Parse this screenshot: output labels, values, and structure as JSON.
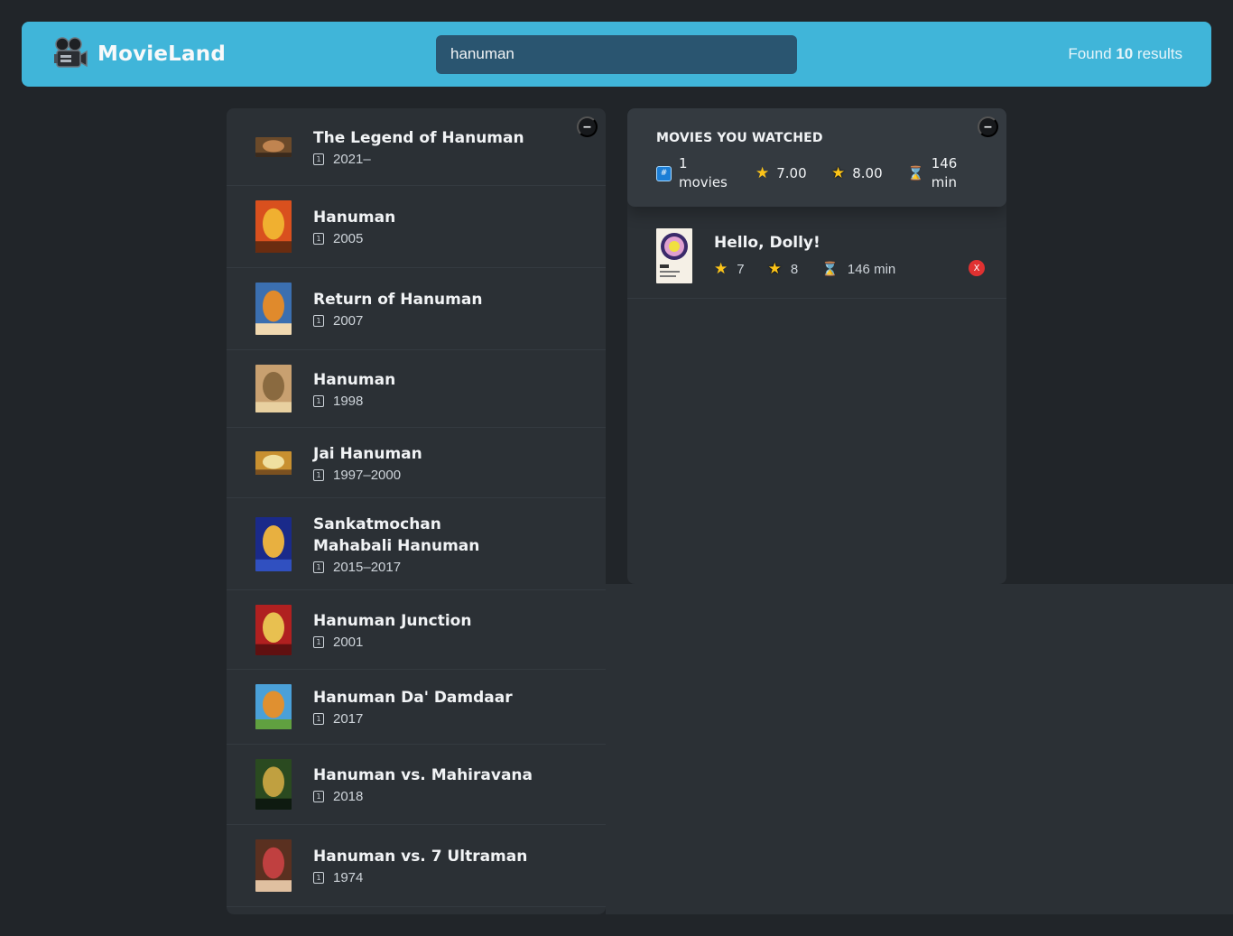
{
  "nav": {
    "logo_text": "MovieLand",
    "search_value": "hanuman",
    "results_prefix": "Found ",
    "results_count": "10",
    "results_suffix": " results"
  },
  "list_toggle": "–",
  "movies": [
    {
      "title": "The Legend of Hanuman",
      "year": "2021–",
      "poster_colors": [
        "#6b4a2a",
        "#c08450",
        "#3a2a1d"
      ]
    },
    {
      "title": "Hanuman",
      "year": "2005",
      "poster_colors": [
        "#d9501e",
        "#f0b030",
        "#6a2c10"
      ]
    },
    {
      "title": "Return of Hanuman",
      "year": "2007",
      "poster_colors": [
        "#3b6fb0",
        "#e08a2c",
        "#f0d8b0"
      ]
    },
    {
      "title": "Hanuman",
      "year": "1998",
      "poster_colors": [
        "#c8a070",
        "#8a6a40",
        "#e8d0a0"
      ]
    },
    {
      "title": "Jai Hanuman",
      "year": "1997–2000",
      "poster_colors": [
        "#c89030",
        "#f0e0a0",
        "#7a5020"
      ]
    },
    {
      "title": "Sankatmochan Mahabali Hanuman",
      "year": "2015–2017",
      "poster_colors": [
        "#1a2a8a",
        "#e8b040",
        "#3050c0"
      ]
    },
    {
      "title": "Hanuman Junction",
      "year": "2001",
      "poster_colors": [
        "#b02020",
        "#e8c050",
        "#601010"
      ]
    },
    {
      "title": "Hanuman Da' Damdaar",
      "year": "2017",
      "poster_colors": [
        "#4aa0d8",
        "#e09030",
        "#60a040"
      ]
    },
    {
      "title": "Hanuman vs. Mahiravana",
      "year": "2018",
      "poster_colors": [
        "#2a4a20",
        "#c0a040",
        "#0e1a10"
      ]
    },
    {
      "title": "Hanuman vs. 7 Ultraman",
      "year": "1974",
      "poster_colors": [
        "#5a3020",
        "#c04040",
        "#e0c0a0"
      ]
    }
  ],
  "summary": {
    "toggle": "–",
    "heading": "Movies you watched",
    "movies_count": "1",
    "movies_label": "movies",
    "avg_imdb": "7.00",
    "avg_user": "8.00",
    "runtime_value": "146",
    "runtime_label": "min"
  },
  "watched": [
    {
      "title": "Hello, Dolly!",
      "imdb": "7",
      "user": "8",
      "runtime": "146 min",
      "delete_label": "X"
    }
  ],
  "icons": {
    "logo": "film-projector-icon",
    "calendar": "calendar-icon",
    "hash": "hash-icon",
    "star": "star-icon",
    "user_star": "glowing-star-icon",
    "hourglass": "hourglass-icon"
  },
  "colors": {
    "accent": "#40b5d9",
    "background": "#212529",
    "panel": "#2b3035",
    "summary": "#343a40",
    "delete": "#e03131"
  }
}
